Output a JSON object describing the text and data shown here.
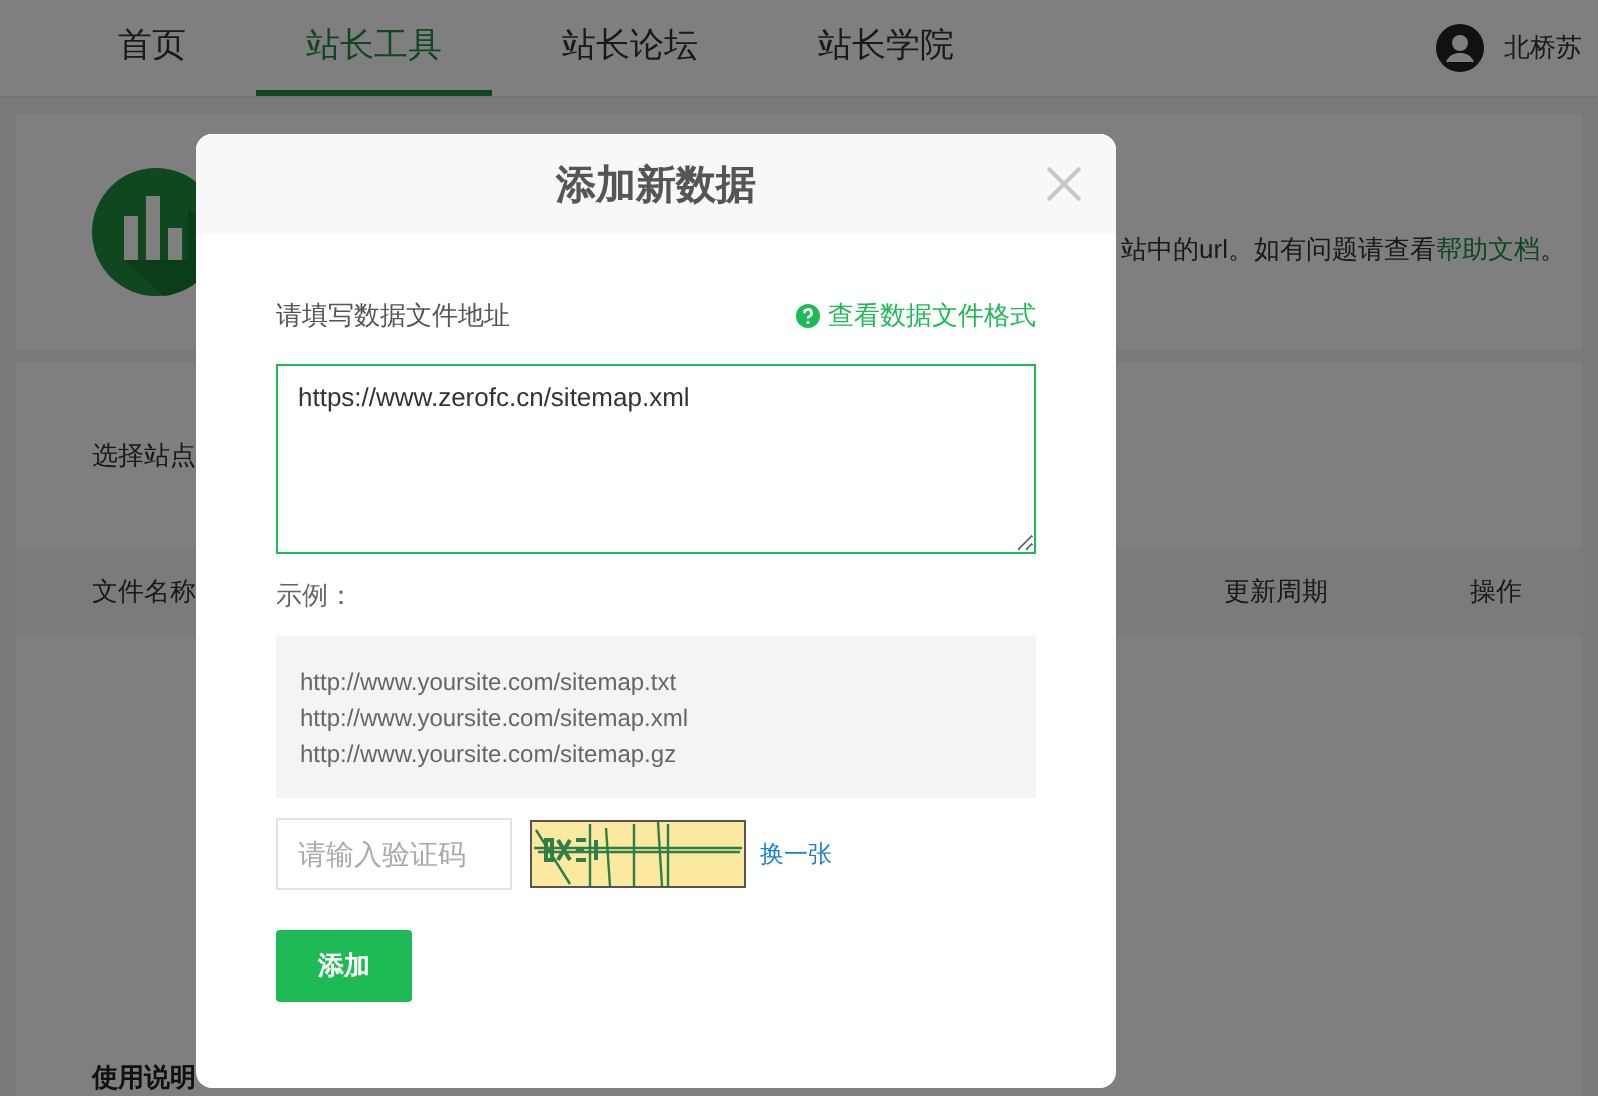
{
  "nav": {
    "tabs": [
      {
        "label": "首页",
        "selected": false
      },
      {
        "label": "站长工具",
        "selected": true
      },
      {
        "label": "站长论坛",
        "selected": false
      },
      {
        "label": "站长学院",
        "selected": false
      }
    ],
    "user": {
      "name": "北桥苏"
    }
  },
  "intro": {
    "text": "站中的url。如有问题请查看",
    "link": "帮助文档",
    "end": "。"
  },
  "site_row": {
    "label": "选择站点"
  },
  "table": {
    "columns": [
      "文件名称",
      "更新周期",
      "操作"
    ]
  },
  "usage": {
    "title": "使用说明"
  },
  "dialog": {
    "title": "添加新数据",
    "field_label": "请填写数据文件地址",
    "format_link": "查看数据文件格式",
    "url_value": "https://www.zerofc.cn/sitemap.xml",
    "example_label": "示例：",
    "examples": [
      "http://www.yoursite.com/sitemap.txt",
      "http://www.yoursite.com/sitemap.xml",
      "http://www.yoursite.com/sitemap.gz"
    ],
    "captcha": {
      "placeholder": "请输入验证码",
      "refresh": "换一张"
    },
    "submit": "添加"
  }
}
